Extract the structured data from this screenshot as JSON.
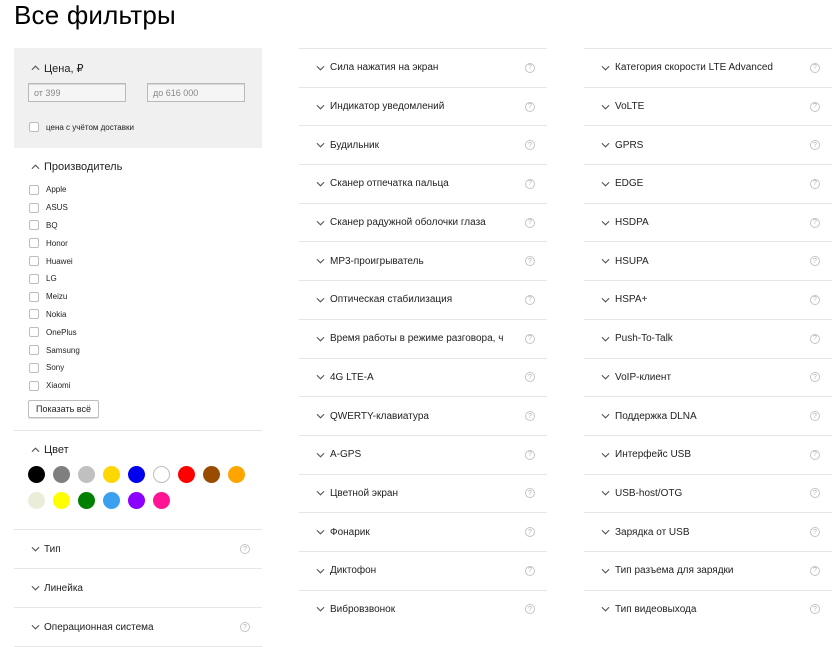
{
  "page": {
    "title": "Все фильтры"
  },
  "price": {
    "label": "Цена, ₽",
    "from_placeholder": "от 399",
    "to_placeholder": "до 616 000",
    "delivery_label": "цена с учётом доставки"
  },
  "manufacturer": {
    "label": "Производитель",
    "brands": [
      "Apple",
      "ASUS",
      "BQ",
      "Honor",
      "Huawei",
      "LG",
      "Meizu",
      "Nokia",
      "OnePlus",
      "Samsung",
      "Sony",
      "Xiaomi"
    ],
    "show_all_label": "Показать всё"
  },
  "color": {
    "label": "Цвет",
    "swatches": [
      {
        "name": "black",
        "hex": "#000000"
      },
      {
        "name": "gray",
        "hex": "#7f7f7f"
      },
      {
        "name": "silver",
        "hex": "#c0c0c0"
      },
      {
        "name": "gold",
        "hex": "#ffd700"
      },
      {
        "name": "blue",
        "hex": "#0000ee"
      },
      {
        "name": "white",
        "hex": "#ffffff"
      },
      {
        "name": "red",
        "hex": "#ff0000"
      },
      {
        "name": "brown",
        "hex": "#994c00"
      },
      {
        "name": "orange",
        "hex": "#ffa500"
      },
      {
        "name": "beige",
        "hex": "#eaeed9"
      },
      {
        "name": "yellow",
        "hex": "#ffff00"
      },
      {
        "name": "green",
        "hex": "#008000"
      },
      {
        "name": "light-blue",
        "hex": "#3ca0f0"
      },
      {
        "name": "purple",
        "hex": "#8b00ff"
      },
      {
        "name": "pink",
        "hex": "#ff1493"
      }
    ]
  },
  "col1_rows": [
    {
      "label": "Тип",
      "help": "?"
    },
    {
      "label": "Линейка",
      "help": ""
    },
    {
      "label": "Операционная система",
      "help": "?"
    }
  ],
  "col2_filters": [
    "Сила нажатия на экран",
    "Индикатор уведомлений",
    "Будильник",
    "Сканер отпечатка пальца",
    "Сканер радужной оболочки глаза",
    "MP3-проигрыватель",
    "Оптическая стабилизация",
    "Время работы в режиме разговора, ч",
    "4G LTE-A",
    "QWERTY-клавиатура",
    "A-GPS",
    "Цветной экран",
    "Фонарик",
    "Диктофон",
    "Вибровзвонок"
  ],
  "col3_filters": [
    "Категория скорости LTE Advanced",
    "VoLTE",
    "GPRS",
    "EDGE",
    "HSDPA",
    "HSUPA",
    "HSPA+",
    "Push-To-Talk",
    "VoIP-клиент",
    "Поддержка DLNA",
    "Интерфейс USB",
    "USB-host/OTG",
    "Зарядка от USB",
    "Тип разъема для зарядки",
    "Тип видеовыхода"
  ],
  "help_glyph": "?",
  "icons": {
    "expanded": "chevron-up-icon",
    "collapsed": "chevron-down-icon",
    "help": "help-icon"
  }
}
